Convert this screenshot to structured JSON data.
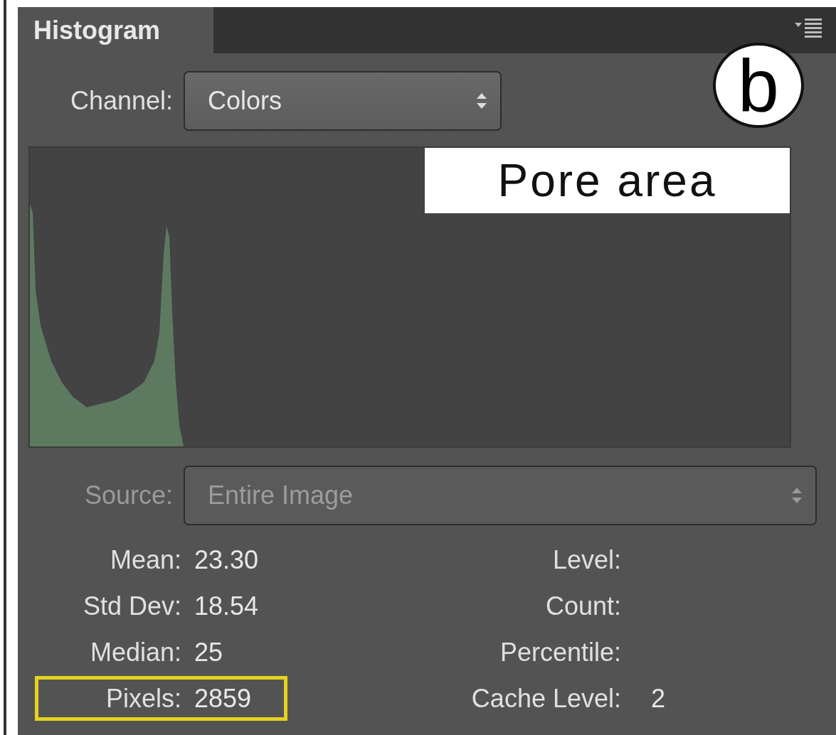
{
  "panel": {
    "tabs": [
      {
        "label": "Histogram",
        "selected": true
      }
    ],
    "badge": "b"
  },
  "channel": {
    "label": "Channel:",
    "value": "Colors"
  },
  "histogram": {
    "overlay_label": "Pore area"
  },
  "source": {
    "label": "Source:",
    "value": "Entire Image",
    "disabled": true
  },
  "stats_left": [
    {
      "label": "Mean:",
      "value": "23.30",
      "highlighted": false
    },
    {
      "label": "Std Dev:",
      "value": "18.54",
      "highlighted": false
    },
    {
      "label": "Median:",
      "value": "25",
      "highlighted": false
    },
    {
      "label": "Pixels:",
      "value": "2859",
      "highlighted": true
    }
  ],
  "stats_right": [
    {
      "label": "Level:"
    },
    {
      "label": "Count:"
    },
    {
      "label": "Percentile:"
    },
    {
      "label": "Cache Level:",
      "value": "2"
    }
  ]
}
